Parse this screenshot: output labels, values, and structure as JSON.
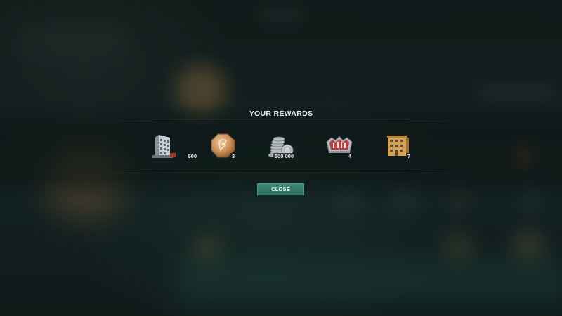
{
  "rewards_modal": {
    "title": "YOUR REWARDS",
    "close_label": "CLOSE",
    "items": [
      {
        "icon": "building-icon",
        "quantity": "500"
      },
      {
        "icon": "bronze-medal-icon",
        "quantity": "3"
      },
      {
        "icon": "coin-stack-icon",
        "quantity": "500 000"
      },
      {
        "icon": "crown-badge-icon",
        "quantity": "4"
      },
      {
        "icon": "apartment-block-icon",
        "quantity": "7"
      }
    ]
  },
  "colors": {
    "accent": "#2d6f60",
    "background": "#142320",
    "text": "#ececec"
  }
}
